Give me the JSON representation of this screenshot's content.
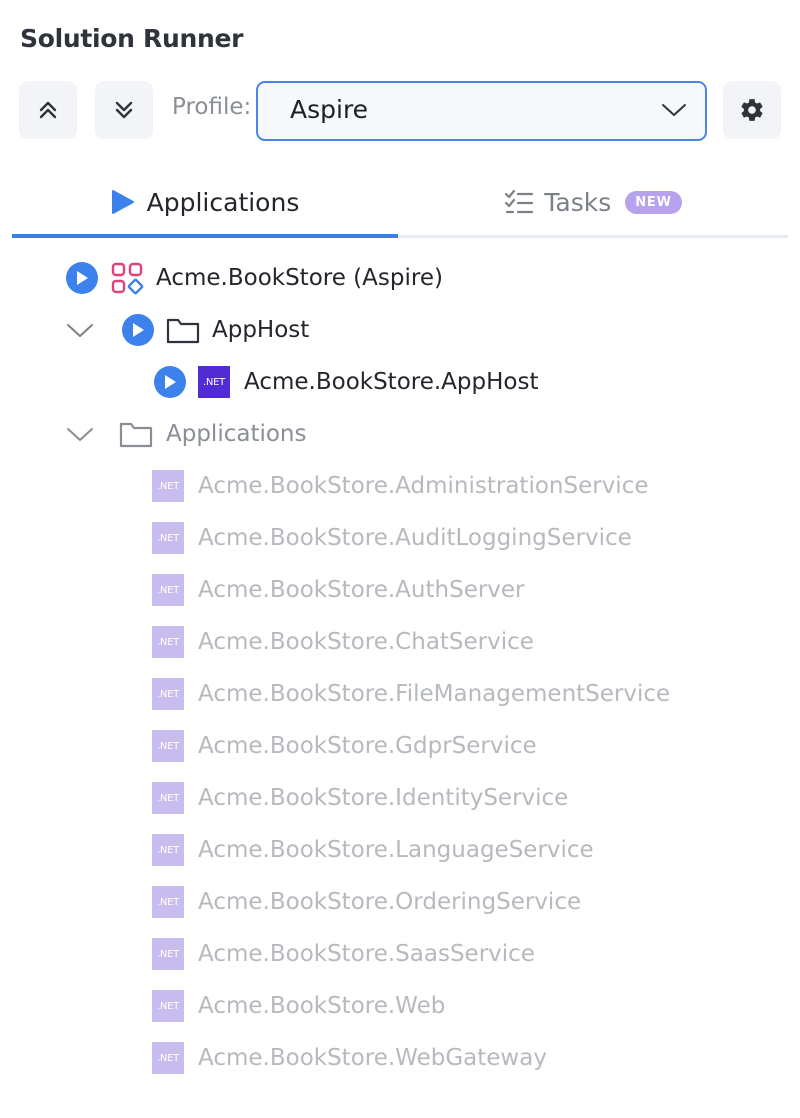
{
  "panel": {
    "title": "Solution Runner"
  },
  "toolbar": {
    "collapse_all_icon": "double-chevron-up-icon",
    "expand_all_icon": "double-chevron-down-icon",
    "profile_label": "Profile:",
    "profile_value": "Aspire",
    "settings_icon": "gear-icon"
  },
  "tabs": [
    {
      "label": "Applications",
      "icon": "play-icon",
      "active": true
    },
    {
      "label": "Tasks",
      "icon": "checklist-icon",
      "badge": "NEW",
      "active": false
    }
  ],
  "tree": {
    "root": {
      "label": "Acme.BookStore (Aspire)",
      "icon": "aspire-icon"
    },
    "apphost_folder": {
      "label": "AppHost",
      "expanded": true
    },
    "apphost_project": {
      "label": "Acme.BookStore.AppHost",
      "net_label": ".NET"
    },
    "applications_folder": {
      "label": "Applications",
      "expanded": true
    },
    "applications": [
      "Acme.BookStore.AdministrationService",
      "Acme.BookStore.AuditLoggingService",
      "Acme.BookStore.AuthServer",
      "Acme.BookStore.ChatService",
      "Acme.BookStore.FileManagementService",
      "Acme.BookStore.GdprService",
      "Acme.BookStore.IdentityService",
      "Acme.BookStore.LanguageService",
      "Acme.BookStore.OrderingService",
      "Acme.BookStore.SaasService",
      "Acme.BookStore.Web",
      "Acme.BookStore.WebGateway"
    ]
  },
  "colors": {
    "accent": "#3d82ec",
    "net_brand": "#512bd4",
    "badge": "#b7a2ee",
    "aspire": "#e0407b"
  }
}
